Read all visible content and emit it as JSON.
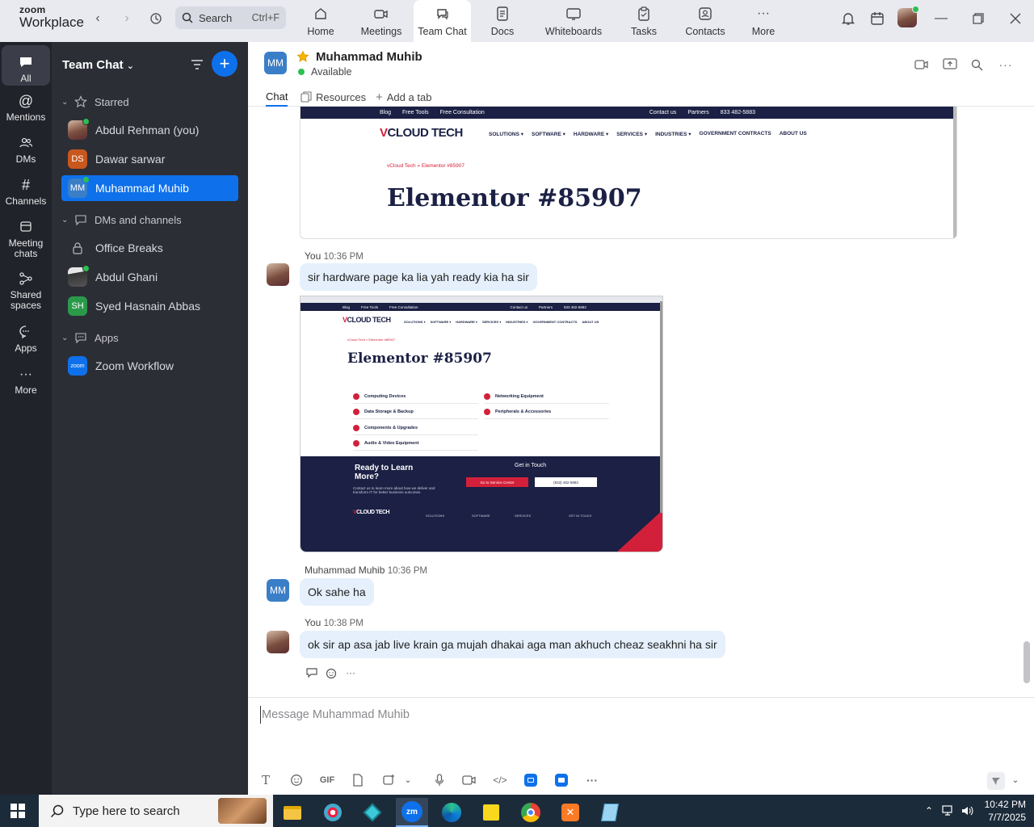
{
  "app": {
    "brand_small": "zoom",
    "brand_large": "Workplace"
  },
  "search": {
    "label": "Search",
    "shortcut": "Ctrl+F"
  },
  "tabs": [
    {
      "label": "Home",
      "icon": "home-icon"
    },
    {
      "label": "Meetings",
      "icon": "video-camera-icon"
    },
    {
      "label": "Team Chat",
      "icon": "chat-bubble-icon",
      "active": true
    },
    {
      "label": "Docs",
      "icon": "document-icon"
    },
    {
      "label": "Whiteboards",
      "icon": "whiteboard-icon"
    },
    {
      "label": "Tasks",
      "icon": "clipboard-icon"
    },
    {
      "label": "Contacts",
      "icon": "contact-card-icon"
    },
    {
      "label": "More",
      "icon": "ellipsis-icon"
    }
  ],
  "rail": [
    {
      "label": "All",
      "icon": "chat-icon",
      "active": true
    },
    {
      "label": "Mentions",
      "icon": "at-sign-icon"
    },
    {
      "label": "DMs",
      "icon": "people-icon"
    },
    {
      "label": "Channels",
      "icon": "hash-icon"
    },
    {
      "label": "Meeting chats",
      "icon": "calendar-chat-icon"
    },
    {
      "label": "Shared spaces",
      "icon": "share-icon"
    },
    {
      "label": "Apps",
      "icon": "apps-chat-icon"
    },
    {
      "label": "More",
      "icon": "ellipsis-icon"
    }
  ],
  "panel": {
    "title": "Team Chat",
    "starred_label": "Starred",
    "starred": [
      {
        "name": "Abdul Rehman (you)",
        "initials": "",
        "color": "#7a4e3e",
        "online": true
      },
      {
        "name": "Dawar sarwar",
        "initials": "DS",
        "color": "#c8571e",
        "online": false
      },
      {
        "name": "Muhammad Muhib",
        "initials": "MM",
        "color": "#3b7ec8",
        "online": true,
        "active": true
      }
    ],
    "dms_label": "DMs and channels",
    "dms": [
      {
        "name": "Office Breaks",
        "initials": "",
        "color": "",
        "locked": true
      },
      {
        "name": "Abdul Ghani",
        "initials": "",
        "color": "#444",
        "online": true
      },
      {
        "name": "Syed Hasnain Abbas",
        "initials": "SH",
        "color": "#2a9a4a",
        "online": false
      }
    ],
    "apps_label": "Apps",
    "apps": [
      {
        "name": "Zoom Workflow",
        "initials": "zoom",
        "color": "#0e71eb"
      }
    ]
  },
  "header": {
    "initials": "MM",
    "name": "Muhammad Muhib",
    "status": "Available",
    "tabs": [
      "Chat",
      "Resources",
      "Add a tab"
    ]
  },
  "shot": {
    "topbar_items": [
      "Blog",
      "Free Tools",
      "Free Consultation"
    ],
    "topbar_right": [
      "Contact us",
      "Partners",
      "833 482-5883"
    ],
    "logo_prefix": "V",
    "logo_rest": "CLOUD TECH",
    "nav": [
      "SOLUTIONS ▾",
      "SOFTWARE ▾",
      "HARDWARE ▾",
      "SERVICES ▾",
      "INDUSTRIES ▾",
      "GOVERNMENT CONTRACTS",
      "ABOUT US"
    ],
    "crumb": "vCloud Tech  »  Elementor #85907",
    "title": "Elementor #85907",
    "list_left": [
      "Computing Devices",
      "Data Storage & Backup",
      "Components & Upgrades",
      "Audio & Video Equipment"
    ],
    "list_right": [
      "Networking Equipment",
      "Peripherals & Accessories"
    ],
    "footer_heading": "Ready to Learn More?",
    "footer_text": "Contact us to learn more about how we deliver and transform IT for better business outcomes.",
    "footer_cta_label": "Get in Touch",
    "footer_btn1": "Go to Service Center",
    "footer_btn2": "(833) 482-5883",
    "footer_cols": [
      "SOLUTIONS",
      "SOFTWARE",
      "SERVICES",
      "GET IN TOUCH"
    ]
  },
  "messages": [
    {
      "sender": "You",
      "time": "10:36 PM",
      "text": "sir hardware page ka lia yah ready kia ha  sir"
    },
    {
      "sender": "Muhammad Muhib",
      "time": "10:36 PM",
      "text": "Ok sahe ha",
      "initials": "MM"
    },
    {
      "sender": "You",
      "time": "10:38 PM",
      "text": "ok sir  ap asa jab live krain ga mujah dhakai aga man akhuch cheaz seakhni ha sir"
    }
  ],
  "composer": {
    "placeholder": "Message Muhammad Muhib",
    "gif_label": "GIF"
  },
  "taskbar": {
    "search_placeholder": "Type here to search",
    "time": "10:42 PM",
    "date": "7/7/2025"
  },
  "colors": {
    "accent": "#0e71eb",
    "bubble": "#e5f0fc",
    "online": "#2dbf4f",
    "sidebar": "#2c2e36",
    "rail": "#21232b"
  }
}
